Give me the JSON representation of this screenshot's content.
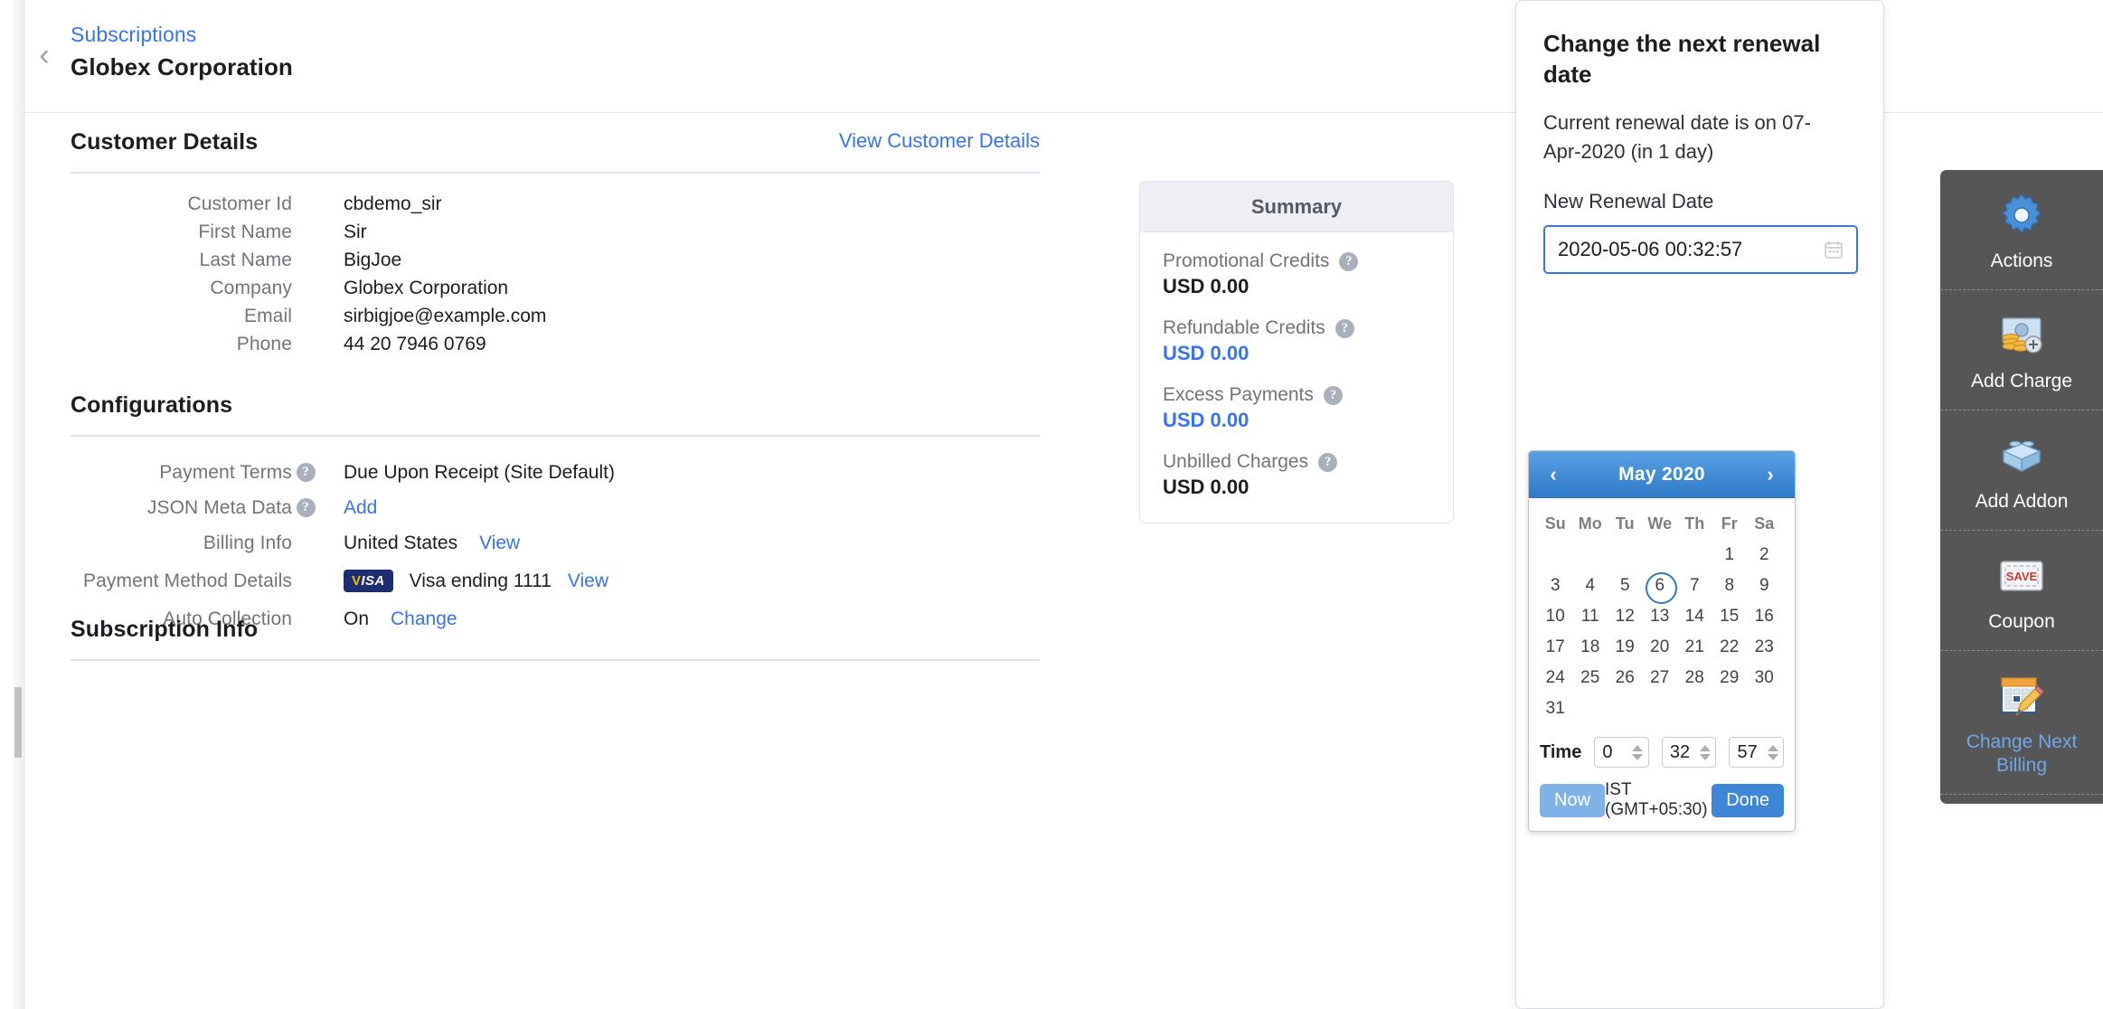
{
  "breadcrumb": {
    "parent": "Subscriptions",
    "title": "Globex Corporation",
    "back_icon": "chevron-left-icon"
  },
  "customer_details": {
    "heading": "Customer Details",
    "view_link": "View Customer Details",
    "rows": [
      {
        "label": "Customer Id",
        "value": "cbdemo_sir"
      },
      {
        "label": "First Name",
        "value": "Sir"
      },
      {
        "label": "Last Name",
        "value": "BigJoe"
      },
      {
        "label": "Company",
        "value": "Globex Corporation"
      },
      {
        "label": "Email",
        "value": "sirbigjoe@example.com"
      },
      {
        "label": "Phone",
        "value": "44 20 7946 0769"
      }
    ]
  },
  "configurations": {
    "heading": "Configurations",
    "payment_terms": {
      "label": "Payment Terms",
      "value": "Due Upon Receipt (Site Default)",
      "help": "help-icon"
    },
    "json_meta": {
      "label": "JSON Meta Data",
      "value": "Add",
      "help": "help-icon"
    },
    "billing_info": {
      "label": "Billing Info",
      "value": "United States",
      "action": "View"
    },
    "payment_method": {
      "label": "Payment Method Details",
      "brand": "VISA",
      "value": "Visa ending 1111",
      "action": "View"
    },
    "auto_collection": {
      "label": "Auto Collection",
      "value": "On",
      "action": "Change"
    }
  },
  "subscription_info": {
    "heading": "Subscription Info"
  },
  "summary": {
    "title": "Summary",
    "items": [
      {
        "label": "Promotional Credits",
        "amount": "USD 0.00",
        "accent": false
      },
      {
        "label": "Refundable Credits",
        "amount": "USD 0.00",
        "accent": true
      },
      {
        "label": "Excess Payments",
        "amount": "USD 0.00",
        "accent": true
      },
      {
        "label": "Unbilled Charges",
        "amount": "USD 0.00",
        "accent": false
      }
    ]
  },
  "renewal_popover": {
    "title": "Change the next renewal date",
    "subtitle": "Current renewal date is on 07-Apr-2020 (in 1 day)",
    "field_label": "New Renewal Date",
    "date_value": "2020-05-06 00:32:57",
    "calendar_icon": "calendar-icon"
  },
  "datepicker": {
    "month": "May 2020",
    "prev_icon": "chevron-left-icon",
    "next_icon": "chevron-right-icon",
    "dow": [
      "Su",
      "Mo",
      "Tu",
      "We",
      "Th",
      "Fr",
      "Sa"
    ],
    "lead_blanks": 5,
    "days": [
      1,
      2,
      3,
      4,
      5,
      6,
      7,
      8,
      9,
      10,
      11,
      12,
      13,
      14,
      15,
      16,
      17,
      18,
      19,
      20,
      21,
      22,
      23,
      24,
      25,
      26,
      27,
      28,
      29,
      30,
      31
    ],
    "selected_day": 6,
    "time_label": "Time",
    "hour": "0",
    "minute": "32",
    "second": "57",
    "now_label": "Now",
    "timezone": "IST (GMT+05:30)",
    "done_label": "Done"
  },
  "action_rail": {
    "items": [
      {
        "label": "Actions",
        "icon": "gear-icon",
        "active": false
      },
      {
        "label": "Add Charge",
        "icon": "money-charge-icon",
        "active": false
      },
      {
        "label": "Add Addon",
        "icon": "addon-block-icon",
        "active": false
      },
      {
        "label": "Coupon",
        "icon": "save-coupon-icon",
        "active": false
      },
      {
        "label": "Change Next Billing",
        "icon": "calendar-edit-icon",
        "active": true
      }
    ]
  },
  "colors": {
    "accent": "#3972f5",
    "rail_bg": "#565656",
    "dp_header": "#2e78c7"
  }
}
